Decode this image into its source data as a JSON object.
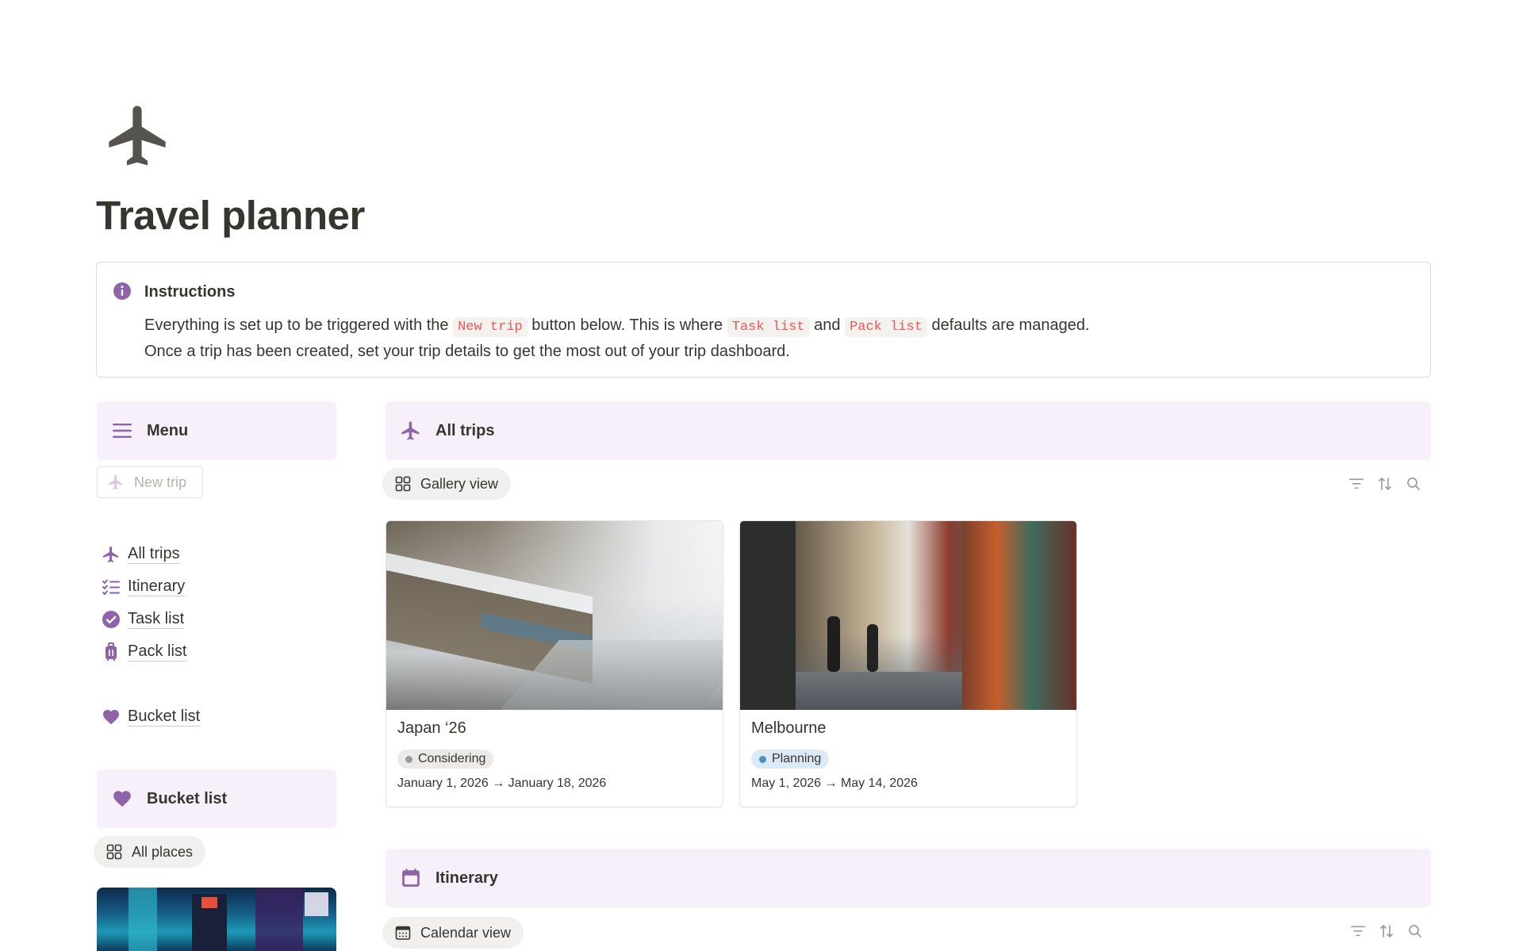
{
  "page": {
    "title": "Travel planner",
    "icon": "airplane-icon"
  },
  "callout": {
    "icon": "info-icon",
    "title": "Instructions",
    "line1_a": "Everything is set up to be triggered with the",
    "code_new_trip": "New trip",
    "line1_b": "button below. This is where",
    "code_task_list": "Task list",
    "line1_c": "and",
    "code_pack_list": "Pack list",
    "line1_d": "defaults are managed.",
    "line2": "Once a trip has been created, set your trip details to get the most out of your trip dashboard."
  },
  "menu": {
    "header": "Menu",
    "header_icon": "hamburger-icon",
    "new_trip_button": "New trip",
    "items": [
      {
        "label": "All trips",
        "icon": "airplane-icon"
      },
      {
        "label": "Itinerary",
        "icon": "checklist-icon"
      },
      {
        "label": "Task list",
        "icon": "check-circle-icon"
      },
      {
        "label": "Pack list",
        "icon": "luggage-icon"
      },
      {
        "label": "Bucket list",
        "icon": "heart-icon"
      }
    ]
  },
  "bucket_section": {
    "header": "Bucket list",
    "header_icon": "heart-icon",
    "view": "All places"
  },
  "trips_section": {
    "header": "All trips",
    "header_icon": "airplane-icon",
    "view": "Gallery view",
    "cards": [
      {
        "name": "Japan ‘26",
        "status": "Considering",
        "status_color": "#9b9a97",
        "status_bg": "#ebeae8",
        "dates": "January 1, 2026 → January 18, 2026"
      },
      {
        "name": "Melbourne",
        "status": "Planning",
        "status_color": "#4b8fc7",
        "status_bg": "#dbeaf6",
        "dates": "May 1, 2026 → May 14, 2026"
      }
    ]
  },
  "itinerary_section": {
    "header": "Itinerary",
    "header_icon": "calendar-icon",
    "view": "Calendar view"
  },
  "colors": {
    "accent": "#8e63a8",
    "band_bg": "#f7f0fb",
    "code_red": "#eb5757"
  }
}
